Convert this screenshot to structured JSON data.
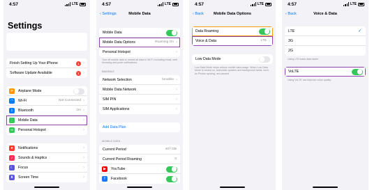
{
  "status_time": "4:57",
  "network": "LTE",
  "screen1": {
    "title": "Settings",
    "group1": [
      {
        "label": "Finish Setting Up Your iPhone",
        "badge": "1"
      },
      {
        "label": "Software Update Available",
        "badge": "1"
      }
    ],
    "group2": [
      {
        "label": "Airplane Mode",
        "icon": "airplane-icon",
        "color": "#ff9500"
      },
      {
        "label": "Wi-Fi",
        "value": "Not Connected",
        "icon": "wifi-icon",
        "color": "#007aff"
      },
      {
        "label": "Bluetooth",
        "value": "On",
        "icon": "bluetooth-icon",
        "color": "#007aff"
      },
      {
        "label": "Mobile Data",
        "icon": "antenna-icon",
        "color": "#34c759"
      },
      {
        "label": "Personal Hotspot",
        "icon": "hotspot-icon",
        "color": "#34c759"
      }
    ],
    "group3": [
      {
        "label": "Notifications",
        "icon": "bell-icon",
        "color": "#ff3b30"
      },
      {
        "label": "Sounds & Haptics",
        "icon": "speaker-icon",
        "color": "#ff2d55"
      },
      {
        "label": "Focus",
        "icon": "moon-icon",
        "color": "#5856d6"
      },
      {
        "label": "Screen Time",
        "icon": "hourglass-icon",
        "color": "#5856d6"
      }
    ]
  },
  "screen2": {
    "back": "Settings",
    "title": "Mobile Data",
    "rows1": [
      {
        "label": "Mobile Data"
      },
      {
        "label": "Mobile Data Options",
        "value": "Roaming On"
      },
      {
        "label": "Personal Hotspot"
      }
    ],
    "note1": "Turn off mobile data to restrict all data to Wi-Fi, including email, web browsing and push notifications.",
    "section_bmobile": "BMOBILE",
    "rows2": [
      {
        "label": "Network Selection",
        "value": "bmobile"
      },
      {
        "label": "Mobile Data Network"
      },
      {
        "label": "SIM PIN"
      },
      {
        "label": "SIM Applications"
      }
    ],
    "add_plan": "Add Data Plan",
    "section_mobile_data": "MOBILE DATA",
    "rows3": [
      {
        "label": "Current Period",
        "value": "407 GB"
      },
      {
        "label": "Current Period Roaming",
        "value": "0"
      }
    ],
    "apps": [
      {
        "label": "YouTube",
        "icon": "youtube-icon",
        "color": "#ff0000"
      },
      {
        "label": "Facebook",
        "icon": "facebook-icon",
        "color": "#1877f2"
      }
    ]
  },
  "screen3": {
    "back": "Back",
    "title": "Mobile Data Options",
    "rows1": [
      {
        "label": "Data Roaming"
      },
      {
        "label": "Voice & Data",
        "value": "LTE"
      }
    ],
    "rows2": [
      {
        "label": "Low Data Mode"
      }
    ],
    "note": "Low Data Mode helps reduce mobile data usage. When Low Data Mode is turned on, automatic updates and background tasks, such as Photos syncing, are paused."
  },
  "screen4": {
    "back": "Back",
    "title": "Voice & Data",
    "options": [
      {
        "label": "LTE",
        "checked": true
      },
      {
        "label": "3G"
      },
      {
        "label": "2G"
      }
    ],
    "note1": "Using LTE loads data faster.",
    "volte": "VoLTE",
    "note2": "Using VoLTE can improve voice quality."
  }
}
